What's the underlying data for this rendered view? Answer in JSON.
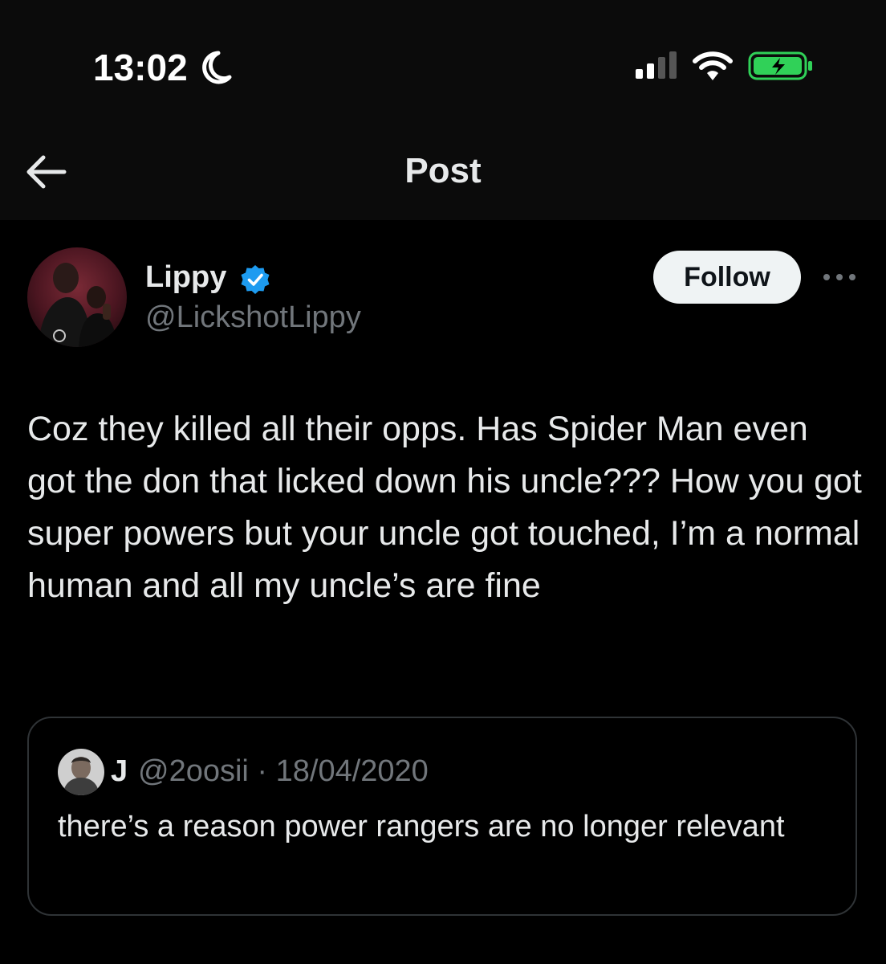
{
  "status_bar": {
    "time": "13:02",
    "icons": [
      "moon-icon",
      "signal-icon",
      "wifi-icon",
      "battery-charging-icon"
    ]
  },
  "nav": {
    "back_icon": "arrow-left-icon",
    "title": "Post"
  },
  "post": {
    "author": {
      "name": "Lippy",
      "handle": "@LickshotLippy",
      "verified": true
    },
    "follow_label": "Follow",
    "more_icon": "ellipsis-icon",
    "text": "Coz they killed all their opps. Has Spider Man even got the don that licked down his uncle??? How you got super powers but your uncle got touched, I’m a normal human and all my uncle’s are fine"
  },
  "quoted_post": {
    "author_name": "J",
    "handle_and_date": "@2oosii · 18/04/2020",
    "text": "there’s a reason power rangers are no longer relevant"
  },
  "colors": {
    "background": "#000000",
    "header": "#0b0b0b",
    "text_primary": "#e7e9ea",
    "text_secondary": "#71767b",
    "verified_blue": "#1d9bf0",
    "battery_green": "#30d158",
    "border": "#2f3336"
  }
}
